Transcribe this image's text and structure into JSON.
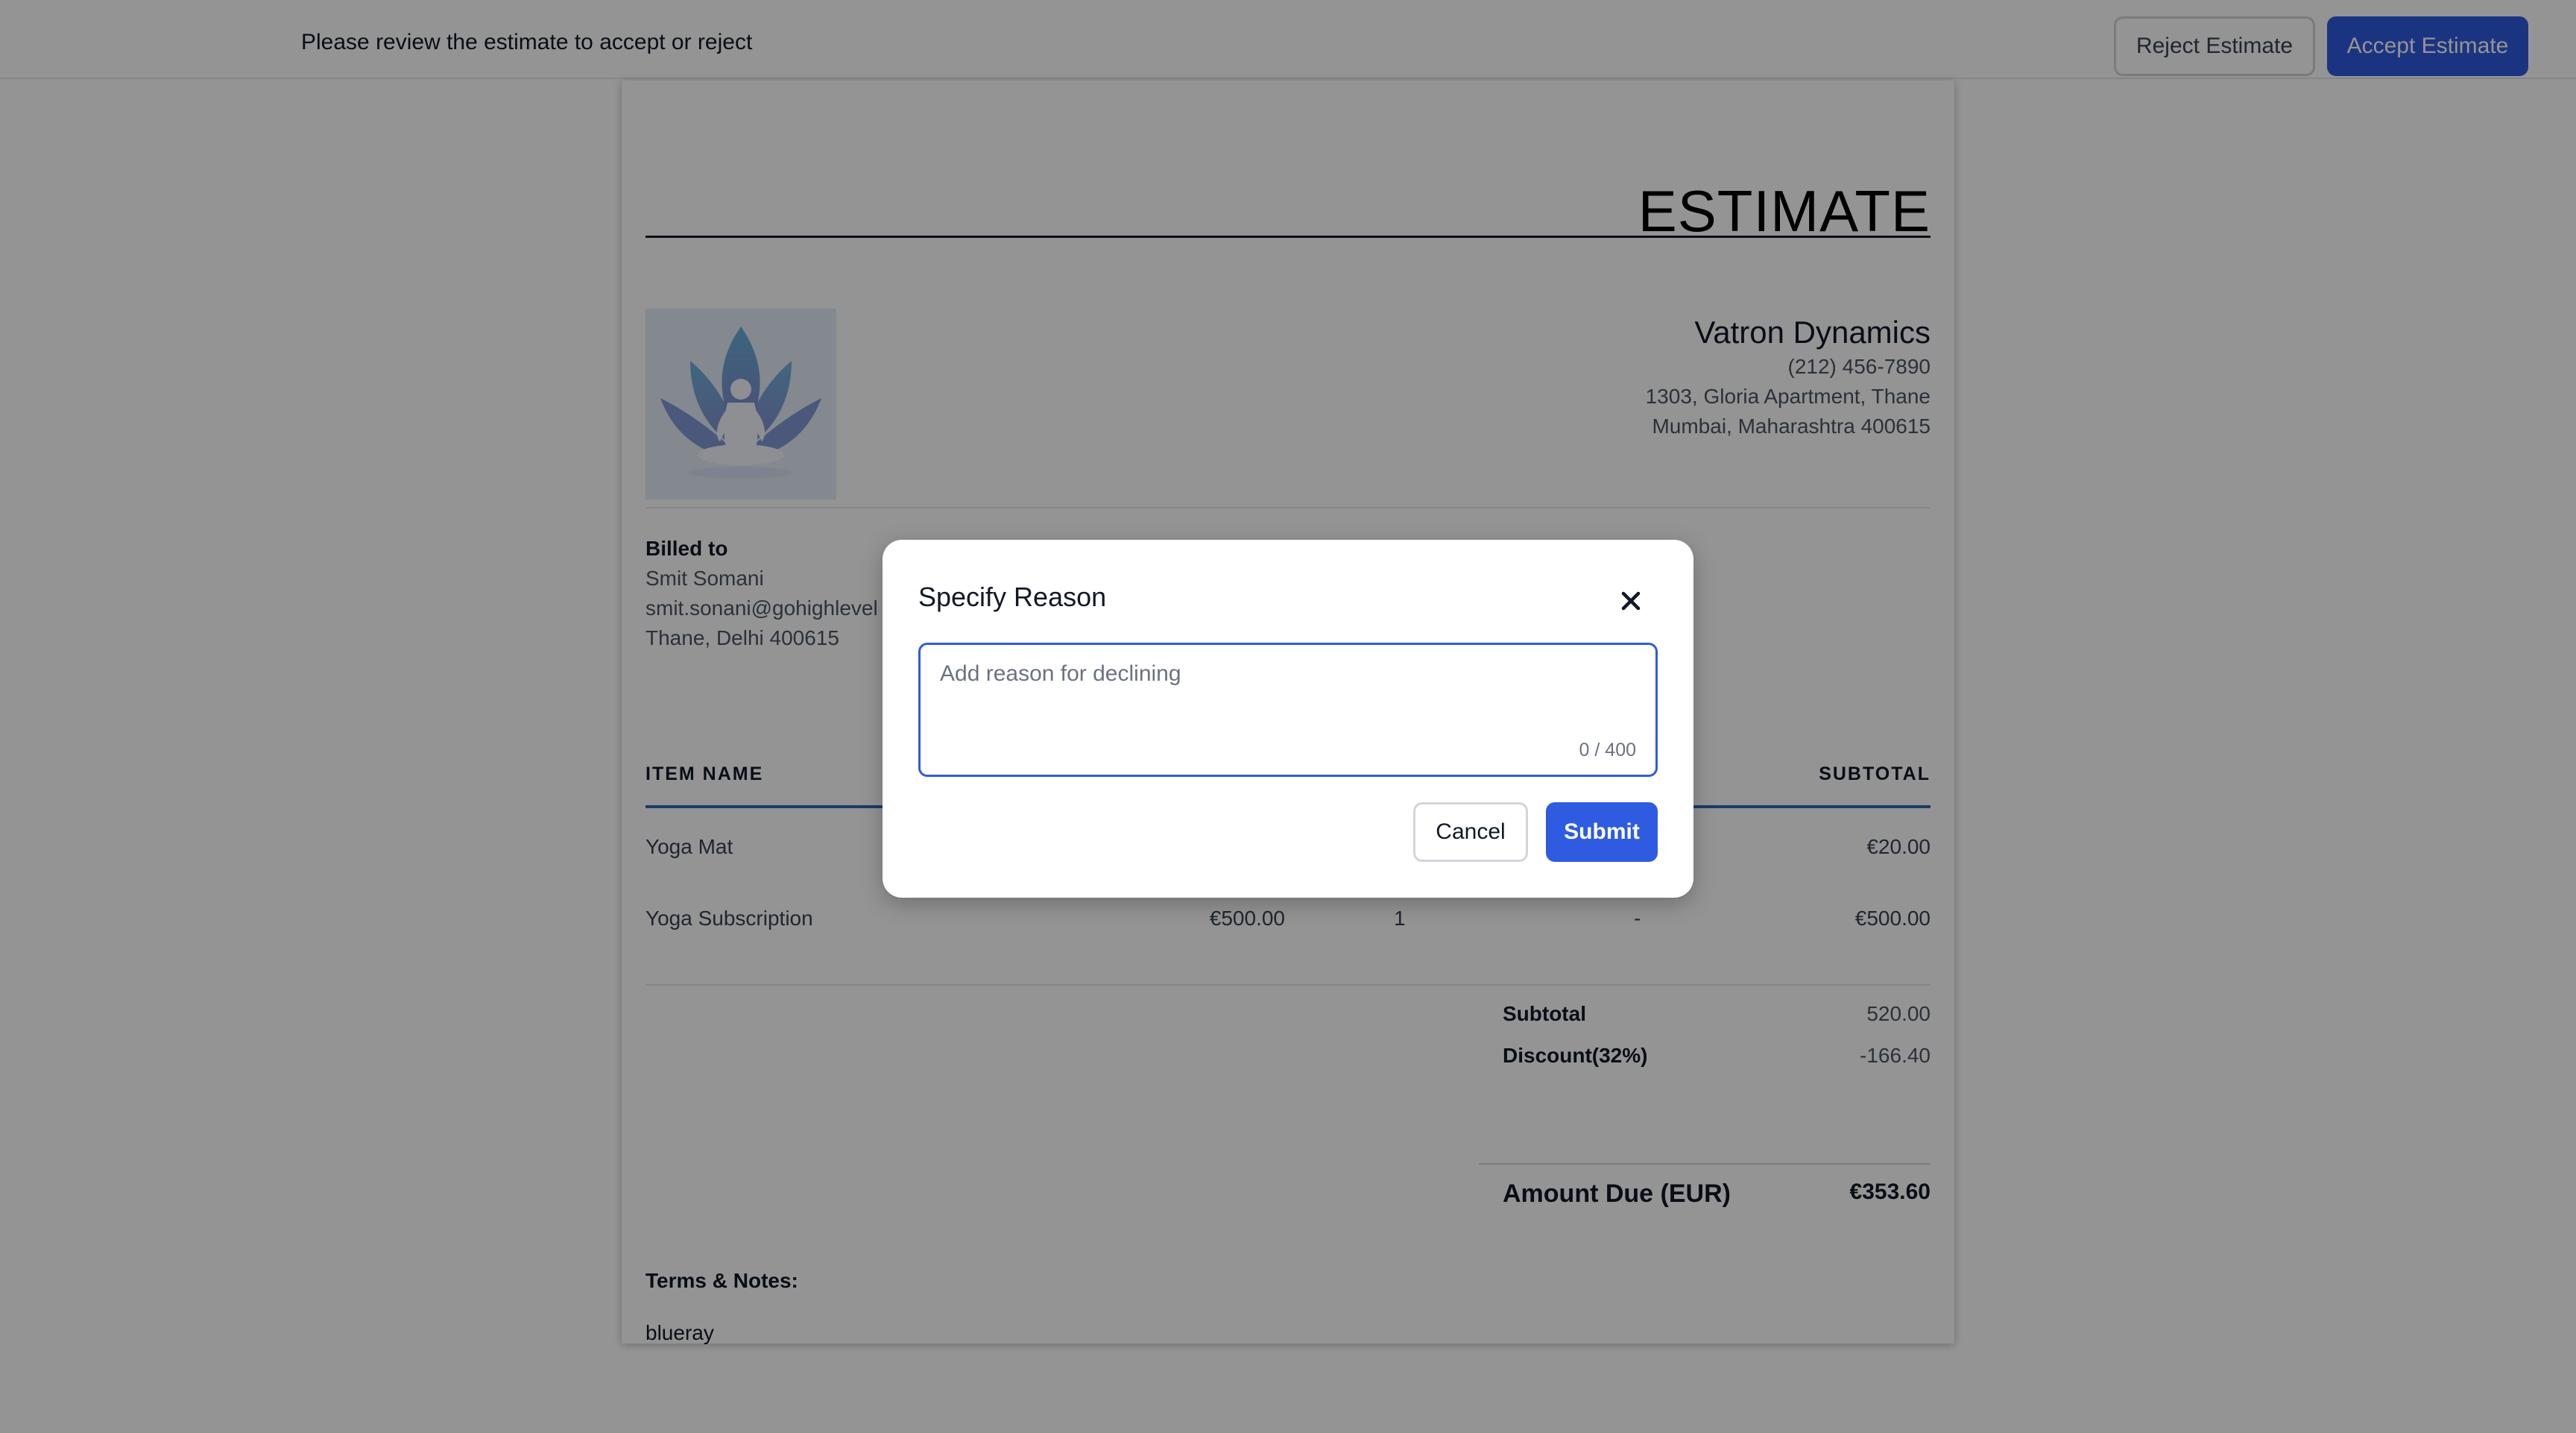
{
  "topbar": {
    "message": "Please review the estimate to accept or reject",
    "reject_label": "Reject Estimate",
    "accept_label": "Accept Estimate"
  },
  "estimate": {
    "title": "ESTIMATE",
    "company": {
      "name": "Vatron Dynamics",
      "phone": "(212) 456-7890",
      "address_line1": "1303, Gloria Apartment, Thane",
      "address_line2": "Mumbai, Maharashtra 400615"
    },
    "billed_to": {
      "label": "Billed to",
      "name": "Smit Somani",
      "email": "smit.sonani@gohighlevel",
      "address": "Thane, Delhi 400615"
    },
    "table": {
      "headers": {
        "item": "ITEM NAME",
        "subtotal": "SUBTOTAL"
      },
      "rows": [
        {
          "name": "Yoga Mat",
          "price": "",
          "qty": "",
          "discount": "",
          "subtotal": "€20.00"
        },
        {
          "name": "Yoga Subscription",
          "price": "€500.00",
          "qty": "1",
          "discount": "-",
          "subtotal": "€500.00"
        }
      ]
    },
    "totals": {
      "subtotal_label": "Subtotal",
      "subtotal_value": "520.00",
      "discount_label": "Discount(32%)",
      "discount_value": "-166.40",
      "due_label": "Amount Due (EUR)",
      "due_value": "€353.60"
    },
    "terms": {
      "label": "Terms & Notes:",
      "text": "blueray"
    }
  },
  "modal": {
    "title": "Specify Reason",
    "placeholder": "Add reason for declining",
    "counter": "0 / 400",
    "cancel_label": "Cancel",
    "submit_label": "Submit"
  },
  "colors": {
    "accent": "#2f5be0",
    "table_rule": "#2e6ab3",
    "overlay": "rgba(0,0,0,0.42)"
  },
  "icons": {
    "logo": "lotus-meditation-logo",
    "close": "close-icon"
  }
}
